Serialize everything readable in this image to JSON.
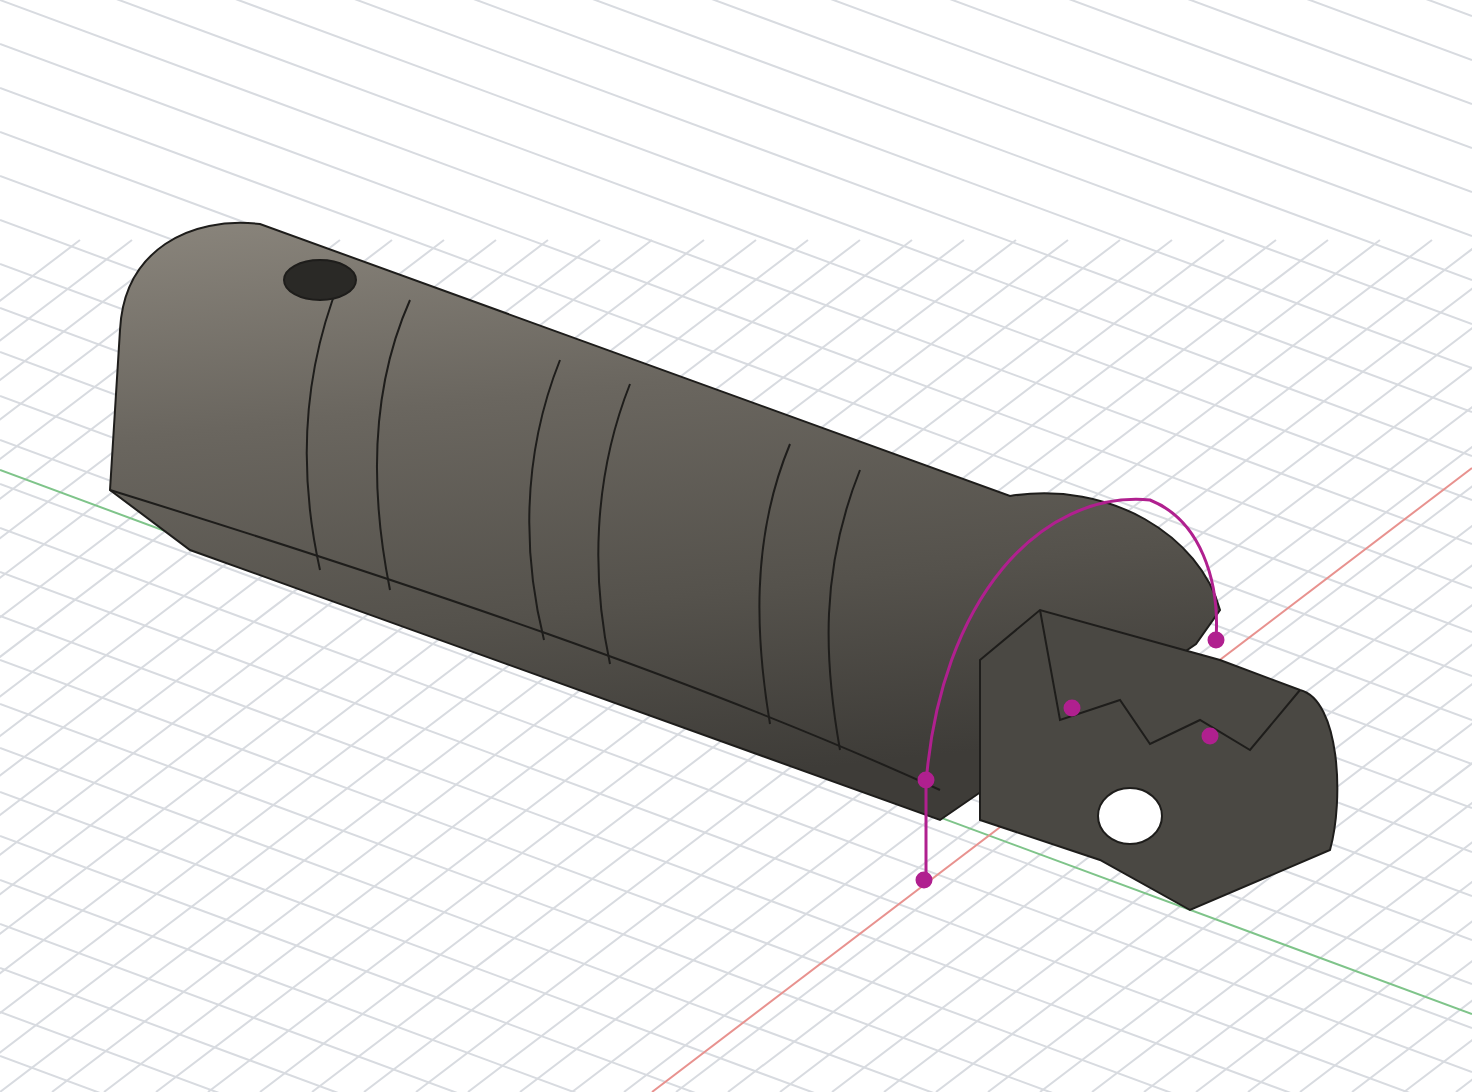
{
  "viewport": {
    "show_grid": true,
    "show_axes": true,
    "show_sketch": true
  }
}
